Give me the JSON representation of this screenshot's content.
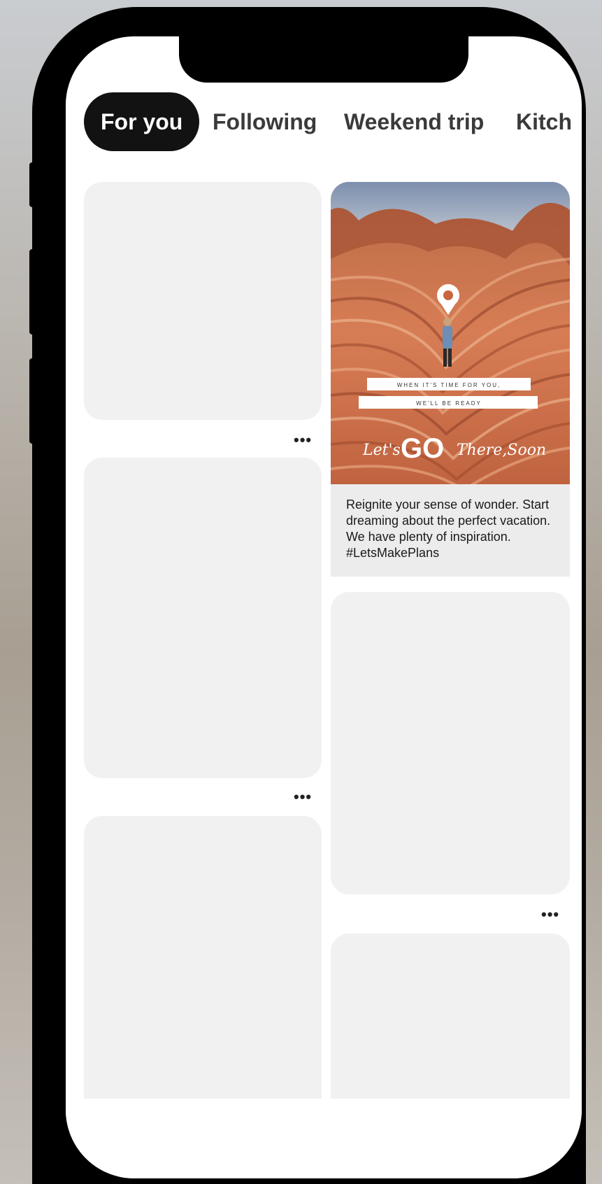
{
  "tabs": [
    {
      "label": "For you",
      "active": true
    },
    {
      "label": "Following",
      "active": false
    },
    {
      "label": "Weekend trip",
      "active": false
    },
    {
      "label": "Kitch",
      "active": false
    }
  ],
  "more_label": "•••",
  "pin": {
    "banner_line1": "WHEN IT'S TIME FOR YOU,",
    "banner_line2": "WE'LL BE READY",
    "brand_lets": "Let's",
    "brand_go": "GO",
    "brand_there": "There,Soon",
    "description": "Reignite your sense of wonder. Start dreaming about the perfect vacation. We have plenty of inspiration. #LetsMakePlans"
  },
  "colors": {
    "active_tab_bg": "#121212",
    "placeholder_card": "#f1f1f1",
    "rock_primary": "#c9653c"
  }
}
